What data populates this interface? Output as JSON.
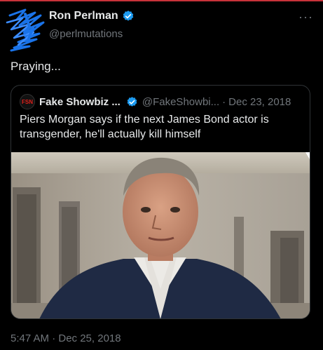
{
  "author": {
    "display_name": "Ron Perlman",
    "handle": "@perlmutations",
    "avatar_icon": "scribbled-out-avatar"
  },
  "more_label": "···",
  "tweet_text": "Praying...",
  "quote": {
    "avatar_label": "FSN",
    "display_name": "Fake Showbiz ...",
    "handle": "@FakeShowbi...",
    "separator": "·",
    "date": "Dec 23, 2018",
    "text": "Piers Morgan says if the next James Bond actor is transgender, he'll actually kill himself"
  },
  "timestamp": "5:47 AM · Dec 25, 2018",
  "colors": {
    "verified_blue": "#1d9bf0",
    "background": "#000000",
    "secondary_text": "#71767b",
    "scribble_blue": "#1a73e8"
  }
}
